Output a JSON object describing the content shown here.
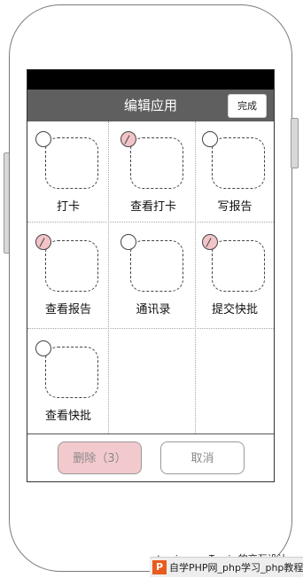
{
  "navbar": {
    "title": "编辑应用",
    "done_label": "完成"
  },
  "apps": [
    {
      "label": "打卡",
      "checked": false
    },
    {
      "label": "查看打卡",
      "checked": true
    },
    {
      "label": "写报告",
      "checked": false
    },
    {
      "label": "查看报告",
      "checked": true
    },
    {
      "label": "通讯录",
      "checked": false
    },
    {
      "label": "提交快批",
      "checked": true
    },
    {
      "label": "查看快批",
      "checked": false
    }
  ],
  "footer": {
    "delete_label": "删除（3）",
    "cancel_label": "取消"
  },
  "watermark": {
    "text": "tomic.cc Tomic的交互设计",
    "logo": "P",
    "site_text": "自学PHP网_php学习_php教程"
  },
  "colors": {
    "navbar": "#5f5f5f",
    "checked_fill": "#f2c4c8",
    "delete_fill": "#f2c9cc"
  }
}
